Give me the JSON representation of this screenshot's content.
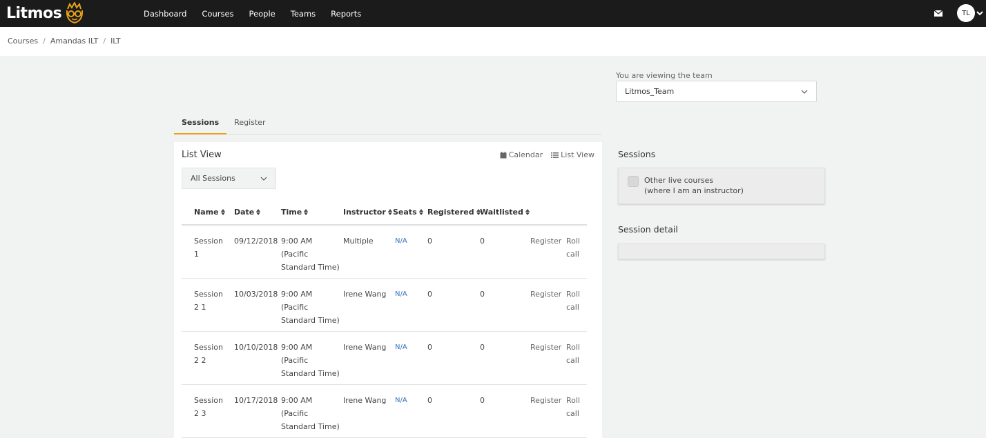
{
  "app": {
    "logo_text": "Litmos"
  },
  "nav": {
    "items": [
      "Dashboard",
      "Courses",
      "People",
      "Teams",
      "Reports"
    ],
    "avatar_initials": "TL"
  },
  "breadcrumb": [
    "Courses",
    "Amandas ILT",
    "ILT"
  ],
  "team": {
    "label": "You are viewing the team",
    "selected": "Litmos_Team"
  },
  "tabs": [
    "Sessions",
    "Register"
  ],
  "list": {
    "title": "List View",
    "calendar_link": "Calendar",
    "list_link": "List View",
    "filter_selected": "All Sessions",
    "columns": [
      "Name",
      "Date",
      "Time",
      "Instructor",
      "Seats",
      "Registered",
      "Waitlisted"
    ],
    "rows": [
      {
        "name": "Session 1",
        "date": "09/12/2018",
        "time": "9:00 AM (Pacific Standard Time)",
        "instructor": "Multiple",
        "seats": "N/A",
        "registered": "0",
        "waitlisted": "0",
        "register": "Register",
        "roll_call": "Roll call"
      },
      {
        "name": "Session 2 1",
        "date": "10/03/2018",
        "time": "9:00 AM (Pacific Standard Time)",
        "instructor": "Irene Wang",
        "seats": "N/A",
        "registered": "0",
        "waitlisted": "0",
        "register": "Register",
        "roll_call": "Roll call"
      },
      {
        "name": "Session 2 2",
        "date": "10/10/2018",
        "time": "9:00 AM (Pacific Standard Time)",
        "instructor": "Irene Wang",
        "seats": "N/A",
        "registered": "0",
        "waitlisted": "0",
        "register": "Register",
        "roll_call": "Roll call"
      },
      {
        "name": "Session 2 3",
        "date": "10/17/2018",
        "time": "9:00 AM (Pacific Standard Time)",
        "instructor": "Irene Wang",
        "seats": "N/A",
        "registered": "0",
        "waitlisted": "0",
        "register": "Register",
        "roll_call": "Roll call"
      }
    ]
  },
  "side": {
    "sessions_title": "Sessions",
    "other_live_line1": "Other live courses",
    "other_live_line2": "(where I am an instructor)",
    "session_detail_title": "Session detail"
  },
  "colors": {
    "topbar": "#1b1b1b",
    "accent": "#e8a317",
    "link_blue": "#2f6fc1"
  }
}
